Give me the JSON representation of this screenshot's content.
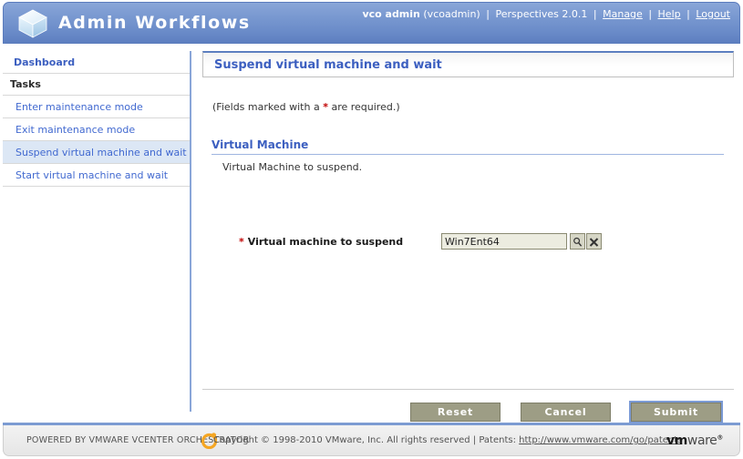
{
  "header": {
    "app_title": "Admin Workflows",
    "logo_icon": "cube-icon",
    "user_name": "vco admin",
    "user_login": "(vcoadmin)",
    "perspectives": "Perspectives 2.0.1",
    "separator": "|",
    "links": [
      {
        "label": "Manage"
      },
      {
        "label": "Help"
      },
      {
        "label": "Logout"
      }
    ]
  },
  "sidebar": {
    "dashboard_label": "Dashboard",
    "section_label": "Tasks",
    "items": [
      {
        "label": "Enter maintenance mode",
        "selected": false
      },
      {
        "label": "Exit maintenance mode",
        "selected": false
      },
      {
        "label": "Suspend virtual machine and wait",
        "selected": true
      },
      {
        "label": "Start virtual machine and wait",
        "selected": false
      }
    ]
  },
  "content": {
    "panel_title": "Suspend virtual machine and wait",
    "required_note_pre": "(Fields marked with a ",
    "required_note_star": "*",
    "required_note_post": " are required.)",
    "section_title": "Virtual Machine",
    "section_description": "Virtual Machine to suspend.",
    "field": {
      "required_star": "*",
      "label": "Virtual machine to suspend",
      "value": "Win7Ent64",
      "placeholder": "",
      "search_icon": "magnifier-icon",
      "clear_icon": "close-x-icon"
    }
  },
  "buttons": {
    "reset_label": "Reset",
    "cancel_label": "Cancel",
    "submit_label": "Submit"
  },
  "footer": {
    "powered_by": "POWERED BY VMWARE VCENTER ORCHESTRATOR",
    "orchestrator_icon": "orchestrator-o-icon",
    "copyright": "Copyright © 1998-2010 VMware, Inc. All rights reserved | Patents: ",
    "patents_url": "http://www.vmware.com/go/patents",
    "brand_vm": "vm",
    "brand_ware": "ware",
    "brand_tm": "®"
  },
  "colors": {
    "header_gradient_top": "#8aa6d8",
    "header_gradient_bottom": "#5d7fc0",
    "accent_blue": "#3c5fc0",
    "link_blue": "#4169d0",
    "selected_row": "#dce7f5",
    "button_olive": "#9d9d85",
    "required_red": "#c00000",
    "input_bg": "#ecece0",
    "footer_bg": "#e6e6e6"
  }
}
